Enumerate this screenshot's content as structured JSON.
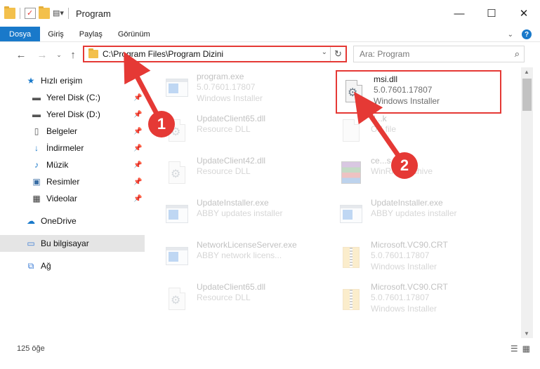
{
  "window": {
    "title": "Program",
    "controls": [
      "minimize-icon",
      "maximize-icon",
      "close-icon"
    ]
  },
  "ribbon": {
    "tabs": [
      {
        "label": "Dosya"
      },
      {
        "label": "Giriş"
      },
      {
        "label": "Paylaş"
      },
      {
        "label": "Görünüm"
      }
    ],
    "help_label": "?"
  },
  "address": {
    "path": "C:\\Program Files\\Program Dizini"
  },
  "search": {
    "placeholder": "Ara: Program"
  },
  "sidebar": {
    "items": [
      {
        "label": "Hızlı erişim",
        "icon": "star-icon"
      },
      {
        "label": "Yerel Disk (C:)",
        "icon": "drive-icon"
      },
      {
        "label": "Yerel Disk (D:)",
        "icon": "drive-icon"
      },
      {
        "label": "Belgeler",
        "icon": "documents-icon"
      },
      {
        "label": "İndirmeler",
        "icon": "download-icon"
      },
      {
        "label": "Müzik",
        "icon": "music-icon"
      },
      {
        "label": "Resimler",
        "icon": "pictures-icon"
      },
      {
        "label": "Videolar",
        "icon": "video-icon"
      },
      {
        "label": "OneDrive",
        "icon": "cloud-icon"
      },
      {
        "label": "Bu bilgisayar",
        "icon": "computer-icon"
      },
      {
        "label": "Ağ",
        "icon": "network-icon"
      }
    ]
  },
  "files": [
    {
      "name": "program.exe",
      "line2": "5.0.7601.17807",
      "line3": "Windows Installer",
      "icon": "installer-icon"
    },
    {
      "name": "msi.dll",
      "line2": "5.0.7601.17807",
      "line3": "Windows Installer",
      "icon": "dll-gears-icon"
    },
    {
      "name": "UpdateClient65.dll",
      "line2": "Resource DLL",
      "line3": "",
      "icon": "dll-icon"
    },
    {
      "name": "d...k",
      "line2": "OK file",
      "line3": "",
      "icon": "blank-file-icon"
    },
    {
      "name": "UpdateClient42.dll",
      "line2": "Resource DLL",
      "line3": "",
      "icon": "dll-icon"
    },
    {
      "name": "ce...s.cab",
      "line2": "WinRAR archive",
      "line3": "",
      "icon": "winrar-icon"
    },
    {
      "name": "UpdateInstaller.exe",
      "line2": "ABBY updates installer",
      "line3": "",
      "icon": "app-window-icon"
    },
    {
      "name": "UpdateInstaller.exe",
      "line2": "ABBY updates installer",
      "line3": "",
      "icon": "app-window-icon"
    },
    {
      "name": "NetworkLicenseServer.exe",
      "line2": "ABBY network licens...",
      "line3": "",
      "icon": "app-window-icon"
    },
    {
      "name": "Microsoft.VC90.CRT",
      "line2": "5.0.7601.17807",
      "line3": "Windows Installer",
      "icon": "zip-folder-icon"
    },
    {
      "name": "UpdateClient65.dll",
      "line2": "Resource DLL",
      "line3": "",
      "icon": "dll-icon"
    },
    {
      "name": "Microsoft.VC90.CRT",
      "line2": "5.0.7601.17807",
      "line3": "Windows Installer",
      "icon": "zip-folder-icon"
    }
  ],
  "status": {
    "count": "125 öğe"
  },
  "annotations": {
    "step1": "1",
    "step2": "2",
    "accent": "#e53935"
  }
}
